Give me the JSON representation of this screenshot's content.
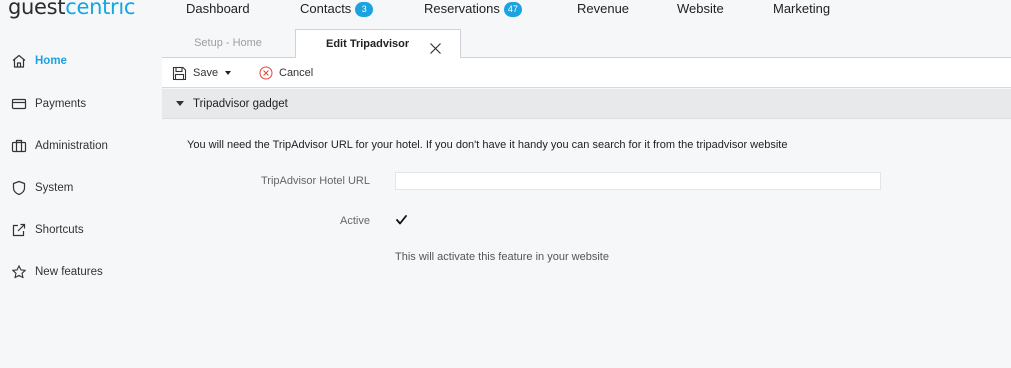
{
  "brand": {
    "name_part1": "guest",
    "name_part2": "centric"
  },
  "nav": {
    "dashboard": "Dashboard",
    "contacts": "Contacts",
    "contacts_badge": "3",
    "reservations": "Reservations",
    "reservations_badge": "47",
    "revenue": "Revenue",
    "website": "Website",
    "marketing": "Marketing"
  },
  "sidebar": {
    "items": [
      {
        "label": "Home",
        "icon": "home-icon",
        "active": true
      },
      {
        "label": "Payments",
        "icon": "credit-card-icon"
      },
      {
        "label": "Administration",
        "icon": "briefcase-icon"
      },
      {
        "label": "System",
        "icon": "shield-icon"
      },
      {
        "label": "Shortcuts",
        "icon": "external-link-icon"
      },
      {
        "label": "New features",
        "icon": "star-icon"
      }
    ]
  },
  "tabs": {
    "inactive": "Setup - Home",
    "active": "Edit Tripadvisor"
  },
  "toolbar": {
    "save": "Save",
    "cancel": "Cancel"
  },
  "section": {
    "title": "Tripadvisor gadget"
  },
  "form": {
    "intro": "You will need the TripAdvisor URL for your hotel. If you don't have it handy you can search for it from the tripadvisor website",
    "url_label": "TripAdvisor Hotel URL",
    "url_value": "",
    "active_label": "Active",
    "active_checked": true,
    "active_help": "This will activate this feature in your website"
  },
  "colors": {
    "accent": "#1ba3df",
    "badge": "#1aa3e0",
    "cancel_icon": "#e0453a"
  }
}
